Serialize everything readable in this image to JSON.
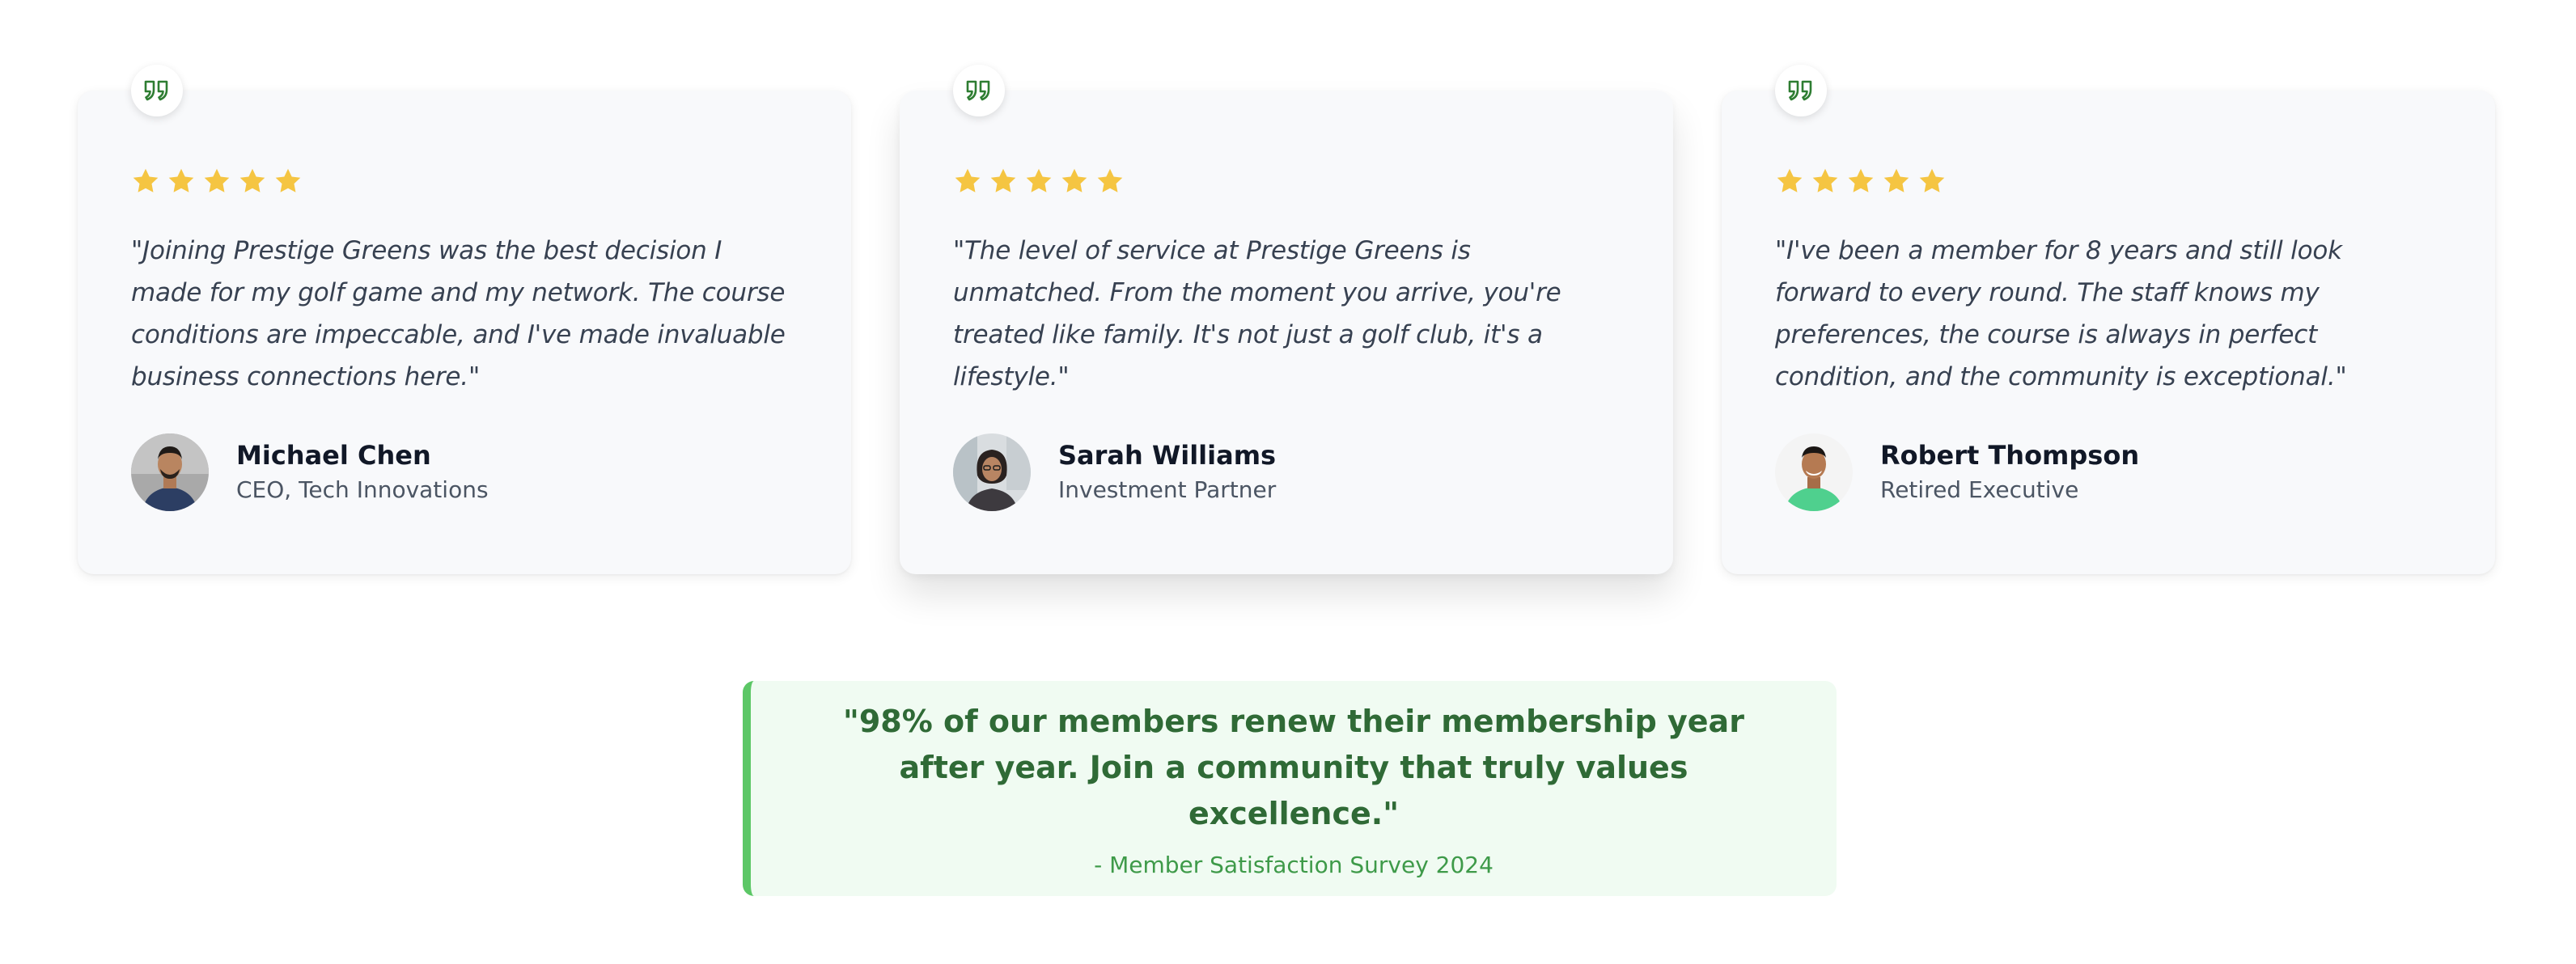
{
  "colors": {
    "star": "#f5c542",
    "quote_icon": "#2e7d32",
    "callout_border": "#5cc766",
    "callout_bg": "#f0fbf2",
    "callout_text": "#2f6a36",
    "callout_source": "#3e9a49"
  },
  "testimonials": [
    {
      "rating": 5,
      "quote": "\"Joining Prestige Greens was the best decision I made for my golf game and my network. The course conditions are impeccable, and I've made invaluable business connections here.\"",
      "name": "Michael Chen",
      "role": "CEO, Tech Innovations",
      "avatar_icon": "avatar-photo"
    },
    {
      "rating": 5,
      "quote": "\"The level of service at Prestige Greens is unmatched. From the moment you arrive, you're treated like family. It's not just a golf club, it's a lifestyle.\"",
      "name": "Sarah Williams",
      "role": "Investment Partner",
      "avatar_icon": "avatar-photo"
    },
    {
      "rating": 5,
      "quote": "\"I've been a member for 8 years and still look forward to every round. The staff knows my preferences, the course is always in perfect condition, and the community is exceptional.\"",
      "name": "Robert Thompson",
      "role": "Retired Executive",
      "avatar_icon": "avatar-photo"
    }
  ],
  "callout": {
    "quote": "\"98% of our members renew their membership year after year. Join a community that truly values excellence.\"",
    "source": "- Member Satisfaction Survey 2024"
  }
}
